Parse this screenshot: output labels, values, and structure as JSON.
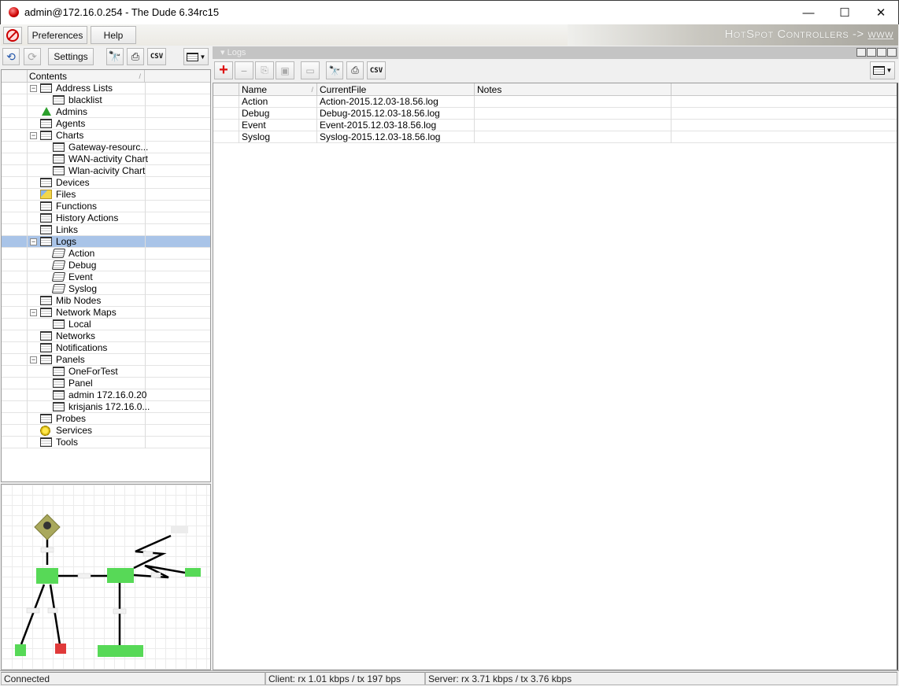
{
  "window": {
    "title": "admin@172.16.0.254 - The Dude 6.34rc15",
    "controls": {
      "minimize": "—",
      "maximize": "☐",
      "close": "✕"
    }
  },
  "menubar": {
    "disconnect_icon": "disconnect-icon",
    "preferences": "Preferences",
    "help": "Help",
    "banner": {
      "text": "HotSpot Controllers ->",
      "link": "www"
    }
  },
  "left_toolbar": {
    "undo": "⟲",
    "redo": "⟳",
    "settings": "Settings",
    "find": "🔍",
    "print": "⎙",
    "csv": "CSV"
  },
  "tree": {
    "header": "Contents",
    "items": [
      {
        "label": "Address Lists",
        "level": 0,
        "icon": "table",
        "expanded": true
      },
      {
        "label": "blacklist",
        "level": 1,
        "icon": "table"
      },
      {
        "label": "Admins",
        "level": 0,
        "icon": "admin"
      },
      {
        "label": "Agents",
        "level": 0,
        "icon": "table"
      },
      {
        "label": "Charts",
        "level": 0,
        "icon": "table",
        "expanded": true
      },
      {
        "label": "Gateway-resourc...",
        "level": 1,
        "icon": "table"
      },
      {
        "label": "WAN-activity Chart",
        "level": 1,
        "icon": "table"
      },
      {
        "label": "Wlan-acivity Chart",
        "level": 1,
        "icon": "table"
      },
      {
        "label": "Devices",
        "level": 0,
        "icon": "table"
      },
      {
        "label": "Files",
        "level": 0,
        "icon": "files"
      },
      {
        "label": "Functions",
        "level": 0,
        "icon": "table"
      },
      {
        "label": "History Actions",
        "level": 0,
        "icon": "table"
      },
      {
        "label": "Links",
        "level": 0,
        "icon": "table"
      },
      {
        "label": "Logs",
        "level": 0,
        "icon": "table",
        "expanded": true,
        "selected": true
      },
      {
        "label": "Action",
        "level": 1,
        "icon": "log"
      },
      {
        "label": "Debug",
        "level": 1,
        "icon": "log"
      },
      {
        "label": "Event",
        "level": 1,
        "icon": "log"
      },
      {
        "label": "Syslog",
        "level": 1,
        "icon": "log"
      },
      {
        "label": "Mib Nodes",
        "level": 0,
        "icon": "table"
      },
      {
        "label": "Network Maps",
        "level": 0,
        "icon": "table",
        "expanded": true
      },
      {
        "label": "Local",
        "level": 1,
        "icon": "table"
      },
      {
        "label": "Networks",
        "level": 0,
        "icon": "table"
      },
      {
        "label": "Notifications",
        "level": 0,
        "icon": "table"
      },
      {
        "label": "Panels",
        "level": 0,
        "icon": "table",
        "expanded": true
      },
      {
        "label": "OneForTest",
        "level": 1,
        "icon": "table"
      },
      {
        "label": "Panel",
        "level": 1,
        "icon": "table"
      },
      {
        "label": "admin 172.16.0.20",
        "level": 1,
        "icon": "table"
      },
      {
        "label": "krisjanis 172.16.0...",
        "level": 1,
        "icon": "table"
      },
      {
        "label": "Probes",
        "level": 0,
        "icon": "table"
      },
      {
        "label": "Services",
        "level": 0,
        "icon": "services"
      },
      {
        "label": "Tools",
        "level": 0,
        "icon": "table"
      }
    ]
  },
  "logs_panel": {
    "title": "Logs",
    "toolbar": {
      "add": "+",
      "remove": "−",
      "copy": "⎘",
      "paste": "📋",
      "comment": "▭",
      "find": "🔍",
      "print": "⎙",
      "csv": "CSV"
    },
    "columns": [
      "Name",
      "CurrentFile",
      "Notes"
    ],
    "rows": [
      {
        "name": "Action",
        "current_file": "Action-2015.12.03-18.56.log",
        "notes": ""
      },
      {
        "name": "Debug",
        "current_file": "Debug-2015.12.03-18.56.log",
        "notes": ""
      },
      {
        "name": "Event",
        "current_file": "Event-2015.12.03-18.56.log",
        "notes": ""
      },
      {
        "name": "Syslog",
        "current_file": "Syslog-2015.12.03-18.56.log",
        "notes": ""
      }
    ]
  },
  "network_map": {
    "node_status_colors": {
      "up": "#4cd64c",
      "down": "#e03a3a",
      "unknown": "#e8e8e8",
      "gateway": "#a8a85a"
    }
  },
  "statusbar": {
    "connection": "Connected",
    "client": "Client: rx 1.01 kbps / tx 197 bps",
    "server": "Server: rx 3.71 kbps / tx 3.76 kbps"
  }
}
